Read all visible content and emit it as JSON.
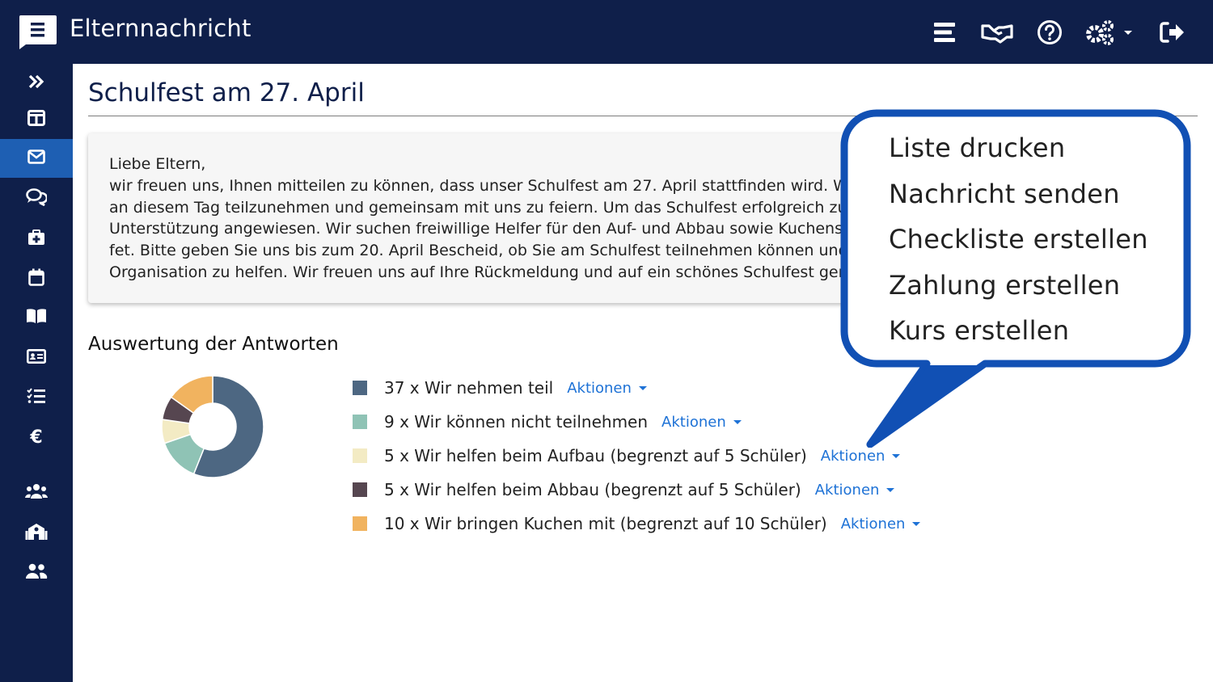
{
  "app": {
    "title": "Elternnachricht"
  },
  "header": {
    "icons": [
      "menu-icon",
      "handshake-icon",
      "help-circle-icon",
      "settings-gears-icon",
      "logout-icon"
    ]
  },
  "sidebar": {
    "items": [
      {
        "icon": "double-chevron-right-icon"
      },
      {
        "icon": "dashboard-icon"
      },
      {
        "icon": "envelope-icon",
        "active": true
      },
      {
        "icon": "chat-bubbles-icon"
      },
      {
        "icon": "first-aid-kit-icon"
      },
      {
        "icon": "calendar-icon"
      },
      {
        "icon": "book-icon"
      },
      {
        "icon": "id-card-icon"
      },
      {
        "icon": "checklist-icon"
      },
      {
        "icon": "euro-icon",
        "glyph": "€"
      },
      {
        "icon": "users-icon"
      },
      {
        "icon": "school-icon"
      },
      {
        "icon": "user-group-icon"
      }
    ]
  },
  "page": {
    "title": "Schulfest am 27. April",
    "message": "Liebe Eltern,\nwir freuen uns, Ihnen mitteilen zu können, dass unser Schulfest am 27. April stattfinden wird. Wir lade\nan diesem Tag teilzunehmen und gemeinsam mit uns zu feiern. Um das Schulfest erfolgreich zu gesta\nUnterstützung angewiesen. Wir suchen freiwillige Helfer für den Auf- und Abbau sowie Kuchenspende\nfet. Bitte geben Sie uns bis zum 20. April Bescheid, ob Sie am Schulfest teilnehmen können und ob Sie\nOrganisation zu helfen. Wir freuen uns auf Ihre Rückmeldung und auf ein schönes Schulfest gemeins"
  },
  "results": {
    "title": "Auswertung der Antworten",
    "items": [
      {
        "label": "37 x Wir nehmen teil",
        "action": "Aktionen",
        "color": "#4d6782",
        "count": 37
      },
      {
        "label": "9 x Wir können nicht teilnehmen",
        "action": "Aktionen",
        "color": "#8fc3b5",
        "count": 9
      },
      {
        "label": "5 x Wir helfen beim Aufbau (begrenzt auf 5 Schüler)",
        "action": "Aktionen",
        "color": "#f3ebc4",
        "count": 5
      },
      {
        "label": "5 x Wir helfen beim Abbau (begrenzt auf 5 Schüler)",
        "action": "Aktionen",
        "color": "#564650",
        "count": 5
      },
      {
        "label": "10 x Wir bringen Kuchen mit (begrenzt auf 10 Schüler)",
        "action": "Aktionen",
        "color": "#f1b35f",
        "count": 10
      }
    ]
  },
  "callout": {
    "items": [
      "Liste drucken",
      "Nachricht senden",
      "Checkliste erstellen",
      "Zahlung erstellen",
      "Kurs erstellen"
    ],
    "border_color": "#1150b4"
  }
}
